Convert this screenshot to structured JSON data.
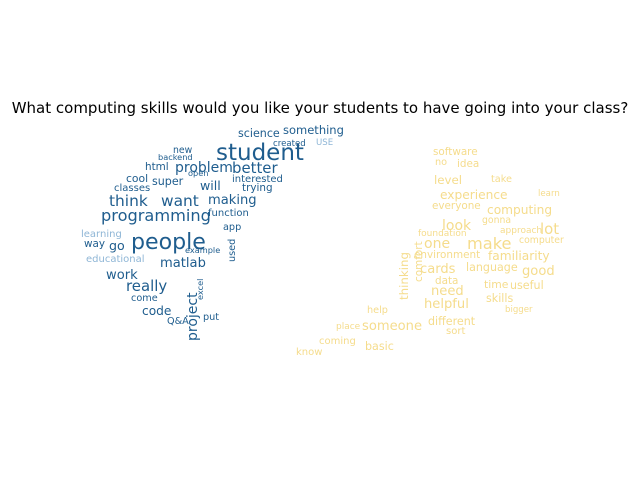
{
  "title": "What computing skills would you like your students to have going into your class?",
  "chart_data": {
    "type": "wordcloud",
    "title": "What computing skills would you like your students to have going into your class?",
    "xlabel": "",
    "ylabel": "",
    "colors": {
      "left_primary": "#1f5d8e",
      "left_secondary": "#8fb6d6",
      "right_primary": "#f5dc8c",
      "right_secondary": "#f9e9b8"
    },
    "clouds": [
      {
        "name": "",
        "color": "#1f5d8e",
        "words": [
          {
            "text": "student",
            "weight": 1.0
          },
          {
            "text": "people",
            "weight": 0.95
          },
          {
            "text": "programming",
            "weight": 0.62
          },
          {
            "text": "think",
            "weight": 0.58
          },
          {
            "text": "want",
            "weight": 0.58
          },
          {
            "text": "better",
            "weight": 0.55
          },
          {
            "text": "really",
            "weight": 0.55
          },
          {
            "text": "project",
            "weight": 0.5
          },
          {
            "text": "problem",
            "weight": 0.5
          },
          {
            "text": "matlab",
            "weight": 0.45
          },
          {
            "text": "work",
            "weight": 0.45
          },
          {
            "text": "making",
            "weight": 0.45
          },
          {
            "text": "will",
            "weight": 0.42
          },
          {
            "text": "code",
            "weight": 0.4
          },
          {
            "text": "go",
            "weight": 0.42
          },
          {
            "text": "something",
            "weight": 0.36
          },
          {
            "text": "science",
            "weight": 0.34
          },
          {
            "text": "super",
            "weight": 0.34
          },
          {
            "text": "cool",
            "weight": 0.32
          },
          {
            "text": "html",
            "weight": 0.3
          },
          {
            "text": "trying",
            "weight": 0.3
          },
          {
            "text": "interested",
            "weight": 0.28
          },
          {
            "text": "classes",
            "weight": 0.28
          },
          {
            "text": "function",
            "weight": 0.28
          },
          {
            "text": "way",
            "weight": 0.3
          },
          {
            "text": "learning",
            "weight": 0.28
          },
          {
            "text": "educational",
            "weight": 0.28
          },
          {
            "text": "come",
            "weight": 0.26
          },
          {
            "text": "put",
            "weight": 0.26
          },
          {
            "text": "Q&A",
            "weight": 0.26
          },
          {
            "text": "used",
            "weight": 0.26
          },
          {
            "text": "app",
            "weight": 0.26
          },
          {
            "text": "new",
            "weight": 0.24
          },
          {
            "text": "USE",
            "weight": 0.2
          },
          {
            "text": "created",
            "weight": 0.2
          },
          {
            "text": "backend",
            "weight": 0.18
          },
          {
            "text": "open",
            "weight": 0.18
          },
          {
            "text": "example",
            "weight": 0.18
          },
          {
            "text": "excel",
            "weight": 0.18
          }
        ]
      },
      {
        "name": "",
        "color": "#f5dc8c",
        "words": [
          {
            "text": "make",
            "weight": 0.62
          },
          {
            "text": "lot",
            "weight": 0.55
          },
          {
            "text": "one",
            "weight": 0.5
          },
          {
            "text": "look",
            "weight": 0.5
          },
          {
            "text": "good",
            "weight": 0.45
          },
          {
            "text": "need",
            "weight": 0.45
          },
          {
            "text": "cards",
            "weight": 0.45
          },
          {
            "text": "helpful",
            "weight": 0.45
          },
          {
            "text": "someone",
            "weight": 0.45
          },
          {
            "text": "computing",
            "weight": 0.4
          },
          {
            "text": "experience",
            "weight": 0.4
          },
          {
            "text": "familiarity",
            "weight": 0.4
          },
          {
            "text": "level",
            "weight": 0.38
          },
          {
            "text": "thinking",
            "weight": 0.38
          },
          {
            "text": "language",
            "weight": 0.34
          },
          {
            "text": "skills",
            "weight": 0.34
          },
          {
            "text": "basic",
            "weight": 0.34
          },
          {
            "text": "different",
            "weight": 0.34
          },
          {
            "text": "useful",
            "weight": 0.34
          },
          {
            "text": "time",
            "weight": 0.32
          },
          {
            "text": "environment",
            "weight": 0.3
          },
          {
            "text": "everyone",
            "weight": 0.3
          },
          {
            "text": "data",
            "weight": 0.3
          },
          {
            "text": "idea",
            "weight": 0.3
          },
          {
            "text": "software",
            "weight": 0.3
          },
          {
            "text": "comfort",
            "weight": 0.3
          },
          {
            "text": "sort",
            "weight": 0.28
          },
          {
            "text": "coming",
            "weight": 0.28
          },
          {
            "text": "know",
            "weight": 0.28
          },
          {
            "text": "help",
            "weight": 0.26
          },
          {
            "text": "take",
            "weight": 0.26
          },
          {
            "text": "computer",
            "weight": 0.24
          },
          {
            "text": "gonna",
            "weight": 0.24
          },
          {
            "text": "approach",
            "weight": 0.22
          },
          {
            "text": "foundation",
            "weight": 0.22
          },
          {
            "text": "place",
            "weight": 0.22
          },
          {
            "text": "bigger",
            "weight": 0.2
          },
          {
            "text": "learn",
            "weight": 0.2
          },
          {
            "text": "no",
            "weight": 0.26
          }
        ]
      }
    ]
  }
}
